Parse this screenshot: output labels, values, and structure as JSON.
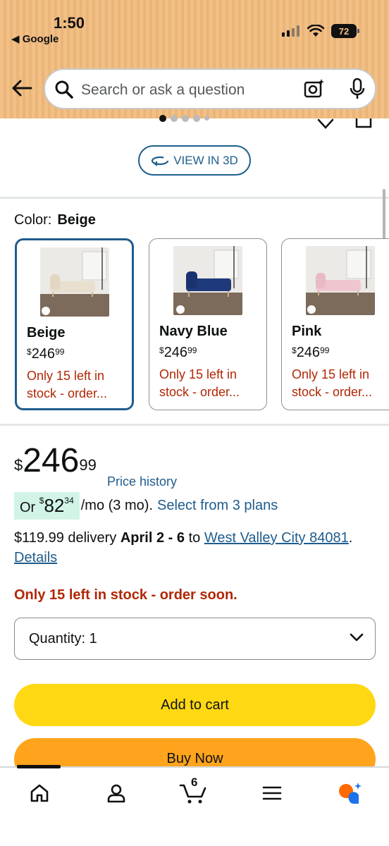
{
  "status_bar": {
    "time": "1:50",
    "back_app": "◀ Google",
    "battery": "72"
  },
  "search": {
    "placeholder": "Search or ask a question"
  },
  "view3d": {
    "label": "VIEW IN 3D"
  },
  "color": {
    "label": "Color:",
    "selected": "Beige"
  },
  "swatches": [
    {
      "name": "Beige",
      "price_currency": "$",
      "price_whole": "246",
      "price_fraction": "99",
      "stock": "Only 15 left in stock - order...",
      "color": "#e9dfcf"
    },
    {
      "name": "Navy Blue",
      "price_currency": "$",
      "price_whole": "246",
      "price_fraction": "99",
      "stock": "Only 15 left in stock - order...",
      "color": "#1f3a7a"
    },
    {
      "name": "Pink",
      "price_currency": "$",
      "price_whole": "246",
      "price_fraction": "99",
      "stock": "Only 15 left in stock - order...",
      "color": "#efc6cf"
    }
  ],
  "price": {
    "currency": "$",
    "whole": "246",
    "fraction": "99",
    "history_link": "Price history"
  },
  "plan": {
    "prefix": "Or ",
    "currency": "$",
    "whole": "82",
    "fraction": "34",
    "suffix": "/mo (3 mo).",
    "link": "Select from 3 plans"
  },
  "delivery": {
    "cost": "$119.99 delivery",
    "dates": "April 2 - 6",
    "to": "to",
    "location": "West Valley City 84081",
    "period": ".",
    "details": "Details"
  },
  "stock_notice": "Only 15 left in stock - order soon.",
  "quantity": {
    "label": "Quantity:",
    "value": "1"
  },
  "buttons": {
    "add_to_cart": "Add to cart",
    "buy_now": "Buy Now"
  },
  "bottom_nav": {
    "cart_count": "6"
  },
  "colors": {
    "accent_link": "#1f5c8d",
    "add_to_cart": "#ffd814",
    "buy_now": "#ffa41c",
    "stock_red": "#b12704"
  }
}
